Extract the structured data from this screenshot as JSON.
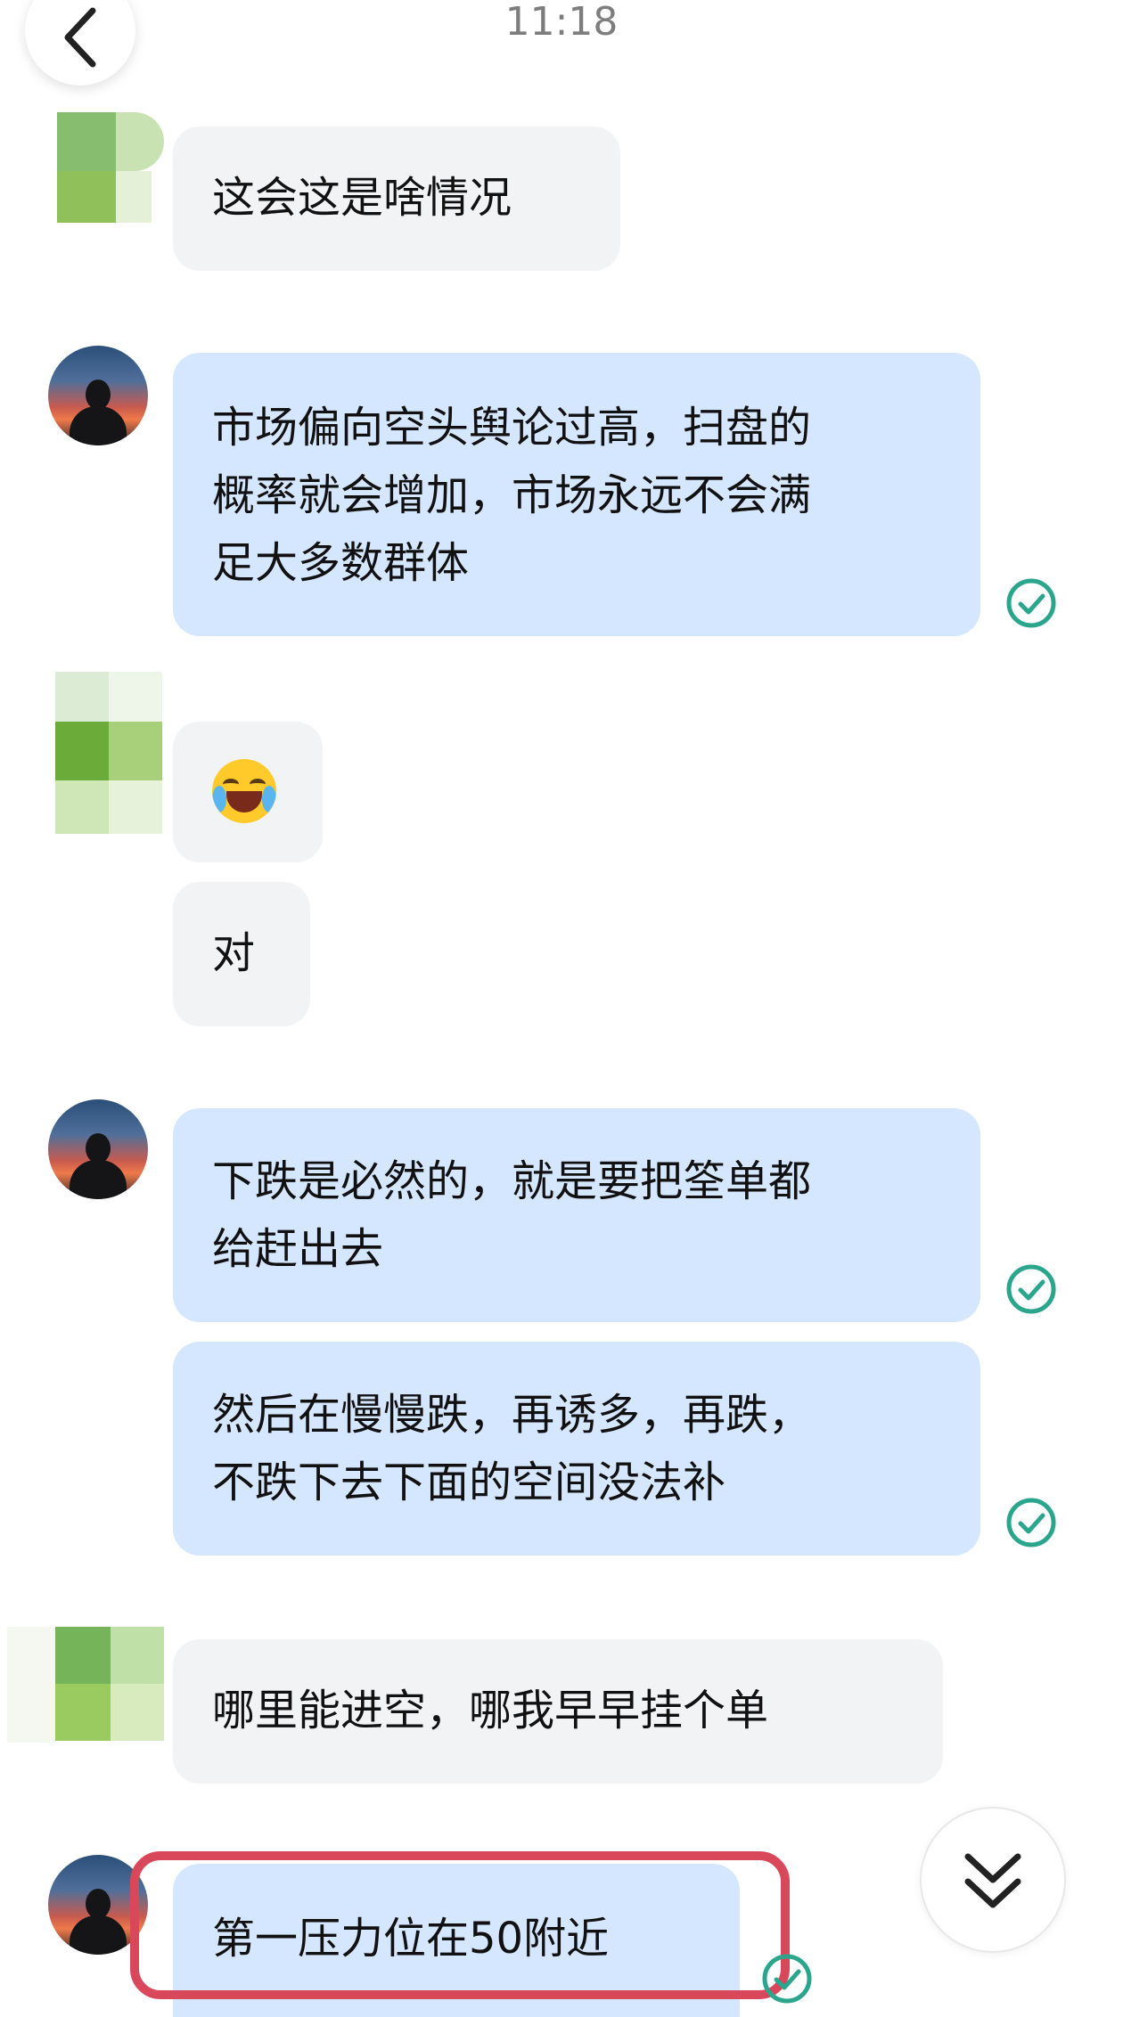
{
  "status_bar": {
    "time": "11:18"
  },
  "icons": {
    "back": "chevron-left-icon",
    "read_receipt": "check-circle-icon",
    "scroll_down": "double-chevron-down-icon"
  },
  "colors": {
    "incoming_bubble": "#f2f3f5",
    "outgoing_bubble": "#d5e6ff",
    "read_check": "#2ba58c",
    "highlight_border": "#d8485a"
  },
  "messages": [
    {
      "side": "left",
      "lines": [
        "这会这是啥情况"
      ]
    },
    {
      "side": "right",
      "lines": [
        "市场偏向空头舆论过高，扫盘的",
        "概率就会增加，市场永远不会满",
        "足大多数群体"
      ]
    },
    {
      "side": "left",
      "emoji": "face-with-tears-of-joy"
    },
    {
      "side": "left",
      "lines": [
        "对"
      ]
    },
    {
      "side": "right",
      "lines": [
        "下跌是必然的，就是要把筌单都",
        "给赶出去"
      ]
    },
    {
      "side": "right",
      "lines": [
        "然后在慢慢跌，再诱多，再跌，",
        "不跌下去下面的空间没法补"
      ]
    },
    {
      "side": "left",
      "lines": [
        "哪里能进空，哪我早早挂个单"
      ]
    },
    {
      "side": "right",
      "lines": [
        "第一压力位在50附近"
      ]
    }
  ]
}
